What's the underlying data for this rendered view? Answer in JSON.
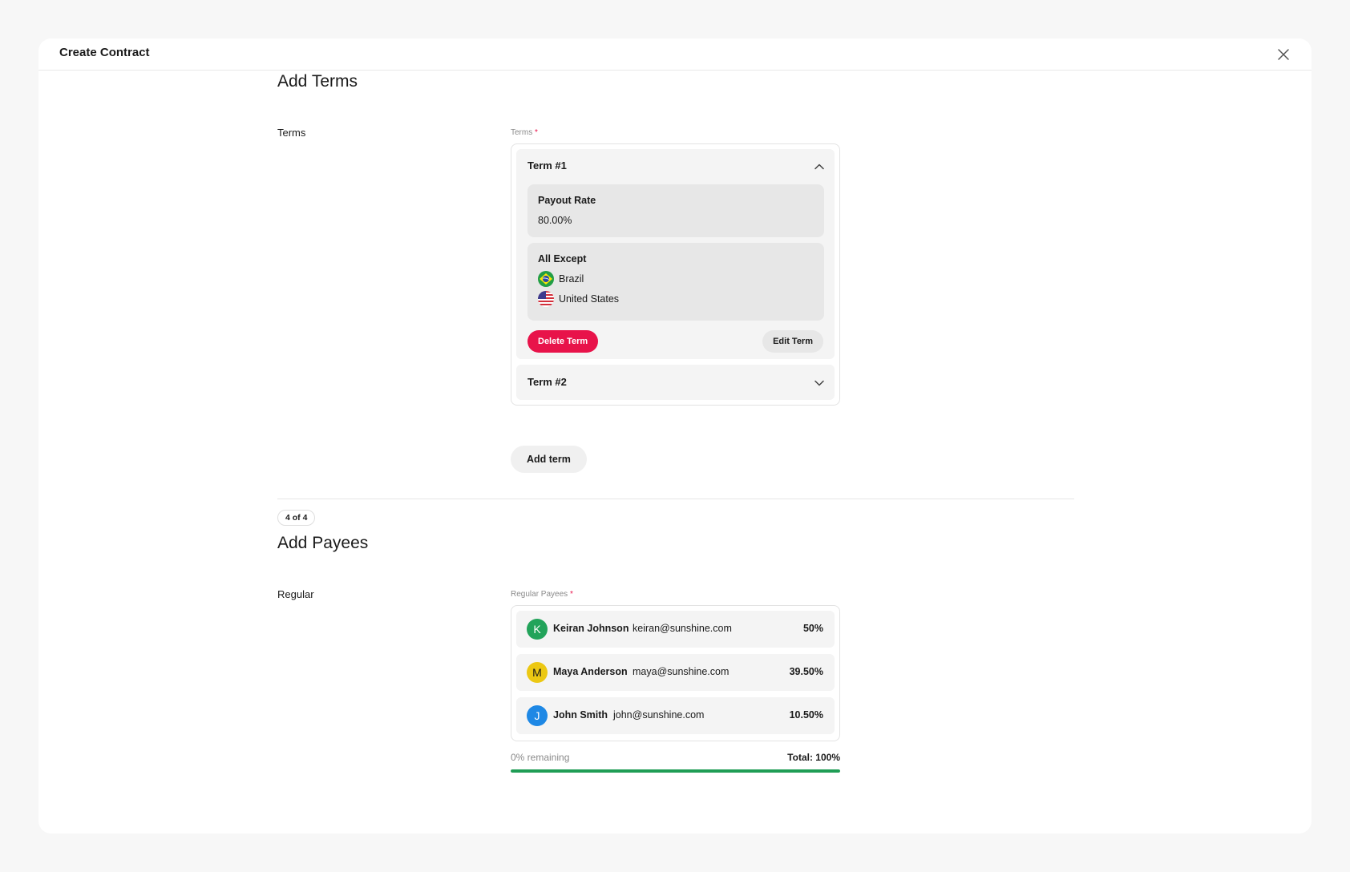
{
  "modal": {
    "title": "Create Contract"
  },
  "terms_section": {
    "title": "Add Terms",
    "row_label": "Terms",
    "field_label": "Terms",
    "required_mark": "*",
    "terms": [
      {
        "title": "Term #1",
        "expanded": true,
        "payout": {
          "label": "Payout Rate",
          "value": "80.00%"
        },
        "territory": {
          "label": "All Except",
          "countries": [
            {
              "name": "Brazil",
              "flag": "brazil-flag-icon"
            },
            {
              "name": "United States",
              "flag": "us-flag-icon"
            }
          ]
        },
        "delete_label": "Delete Term",
        "edit_label": "Edit Term"
      },
      {
        "title": "Term #2",
        "expanded": false
      }
    ],
    "add_label": "Add term"
  },
  "payees_section": {
    "step": "4 of 4",
    "title": "Add Payees",
    "row_label": "Regular",
    "field_label": "Regular Payees",
    "required_mark": "*",
    "payees": [
      {
        "initial": "K",
        "name": "Keiran Johnson",
        "email": "keiran@sunshine.com",
        "share": "50%",
        "color": "#22a35a"
      },
      {
        "initial": "M",
        "name": "Maya Anderson",
        "email": "maya@sunshine.com",
        "share": "39.50%",
        "color": "#ecc813"
      },
      {
        "initial": "J",
        "name": "John Smith",
        "email": "john@sunshine.com",
        "share": "10.50%",
        "color": "#1e88e5"
      }
    ],
    "remaining": "0% remaining",
    "total_label": "Total:",
    "total_value": "100%",
    "allocated_fraction": 1.0
  },
  "colors": {
    "danger": "#e8134a",
    "success": "#1f9d55"
  }
}
